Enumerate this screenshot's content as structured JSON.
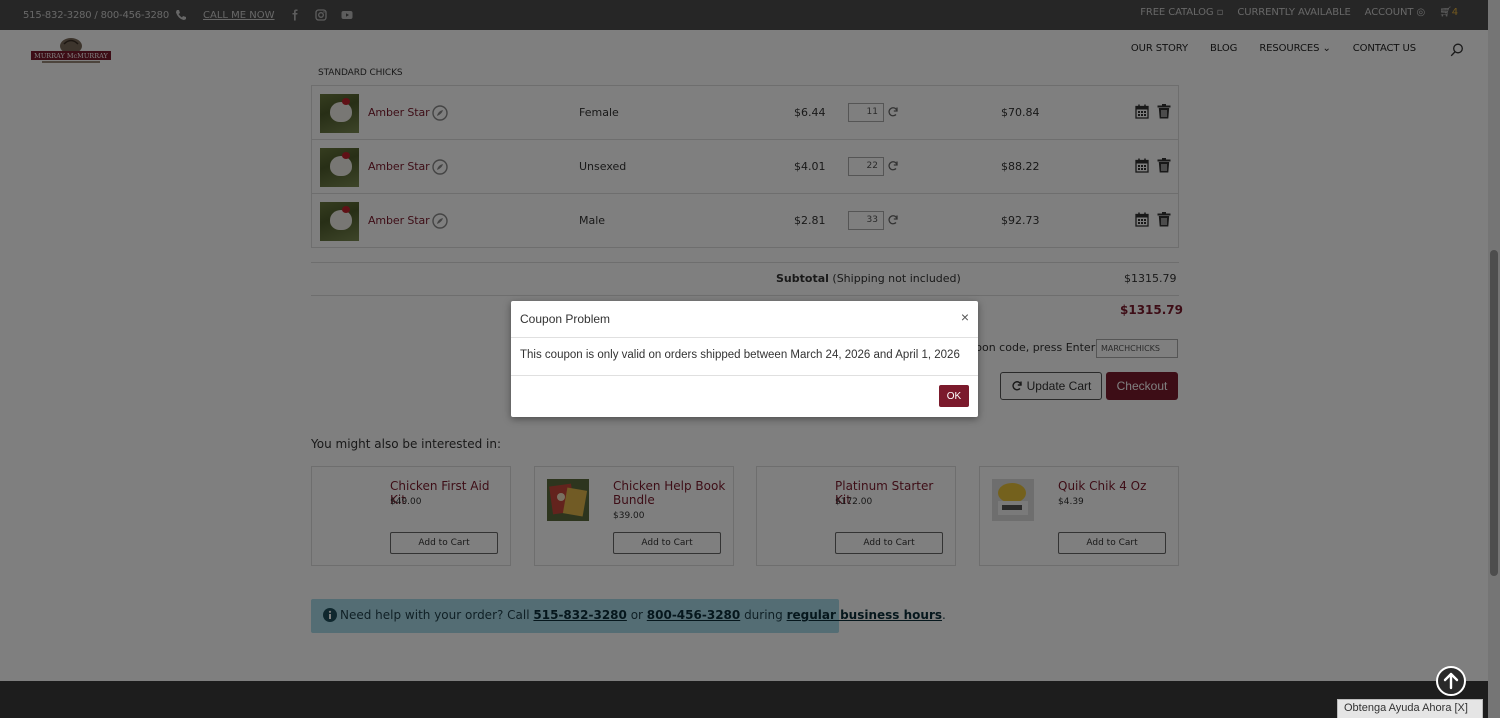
{
  "topbar": {
    "phones": "515-832-3280 / 800-456-3280",
    "call_me": "CALL ME NOW",
    "links": [
      "FREE CATALOG",
      "CURRENTLY AVAILABLE",
      "ACCOUNT"
    ],
    "cart_count": "4"
  },
  "header": {
    "logo_text": "MURRAY McMURRAY",
    "nav": [
      "OUR STORY",
      "BLOG",
      "RESOURCES",
      "CONTACT US"
    ]
  },
  "cart": {
    "section_label": "STANDARD CHICKS",
    "rows": [
      {
        "name": "Amber Star",
        "sex": "Female",
        "price": "$6.44",
        "qty": "11",
        "total": "$70.84"
      },
      {
        "name": "Amber Star",
        "sex": "Unsexed",
        "price": "$4.01",
        "qty": "22",
        "total": "$88.22"
      },
      {
        "name": "Amber Star",
        "sex": "Male",
        "price": "$2.81",
        "qty": "33",
        "total": "$92.73"
      }
    ],
    "subtotal_label": "Subtotal",
    "subtotal_note": "(Shipping not included)",
    "subtotal_value": "$1315.79",
    "grand_total": "$1315.79",
    "coupon_label": "pon code, press Enter:",
    "coupon_value": "MARCHCHICKS",
    "update_button": "Update Cart",
    "checkout_button": "Checkout"
  },
  "also": {
    "title": "You might also be interested in:",
    "products": [
      {
        "name": "Chicken First Aid Kit",
        "price": "$49.00",
        "button": "Add to Cart"
      },
      {
        "name": "Chicken Help Book Bundle",
        "price": "$39.00",
        "button": "Add to Cart"
      },
      {
        "name": "Platinum Starter Kit",
        "price": "$172.00",
        "button": "Add to Cart"
      },
      {
        "name": "Quik Chik 4 Oz",
        "price": "$4.39",
        "button": "Add to Cart"
      }
    ]
  },
  "help": {
    "prefix": "Need help with your order? Call ",
    "phone1": "515-832-3280",
    "or": " or ",
    "phone2": "800-456-3280",
    "during": " during ",
    "hours": "regular business hours",
    "suffix": "."
  },
  "chat": {
    "label": "Obtenga Ayuda Ahora [X]"
  },
  "modal": {
    "title": "Coupon Problem",
    "close": "×",
    "message": "This coupon is only valid on orders shipped between March 24, 2026 and April 1, 2026",
    "ok": "OK"
  },
  "colors": {
    "brand": "#7b1a2c",
    "help_bg": "#a9dbe8",
    "topbar": "#4d4d4d"
  }
}
